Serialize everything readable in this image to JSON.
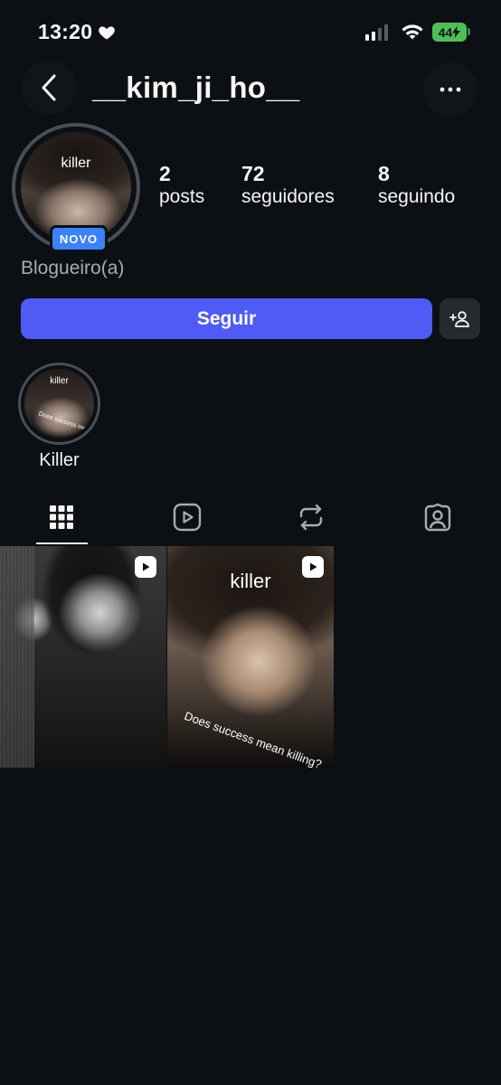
{
  "status_bar": {
    "time": "13:20",
    "battery": "44"
  },
  "header": {
    "username": "__kim_ji_ho__"
  },
  "profile": {
    "avatar_text": "killer",
    "new_badge": "NOVO",
    "category": "Blogueiro(a)",
    "stats": [
      {
        "num": "2",
        "label": "posts"
      },
      {
        "num": "72",
        "label": "seguidores"
      },
      {
        "num": "8",
        "label": "seguindo"
      }
    ]
  },
  "actions": {
    "follow_label": "Seguir"
  },
  "highlights": [
    {
      "label": "Killer",
      "image_text": "killer",
      "image_subtext": "Does success mean..."
    }
  ],
  "tabs": [
    {
      "name": "grid",
      "icon": "grid-icon"
    },
    {
      "name": "reels",
      "icon": "reels-icon"
    },
    {
      "name": "reposts",
      "icon": "repost-icon"
    },
    {
      "name": "tagged",
      "icon": "tagged-icon"
    }
  ],
  "posts": [
    {
      "type": "reel"
    },
    {
      "type": "reel",
      "title": "killer",
      "caption": "Does success mean killing?"
    }
  ],
  "colors": {
    "background": "#0c1014",
    "accent": "#4f5bf5",
    "badge": "#3b82f6",
    "battery": "#4fbe57"
  }
}
